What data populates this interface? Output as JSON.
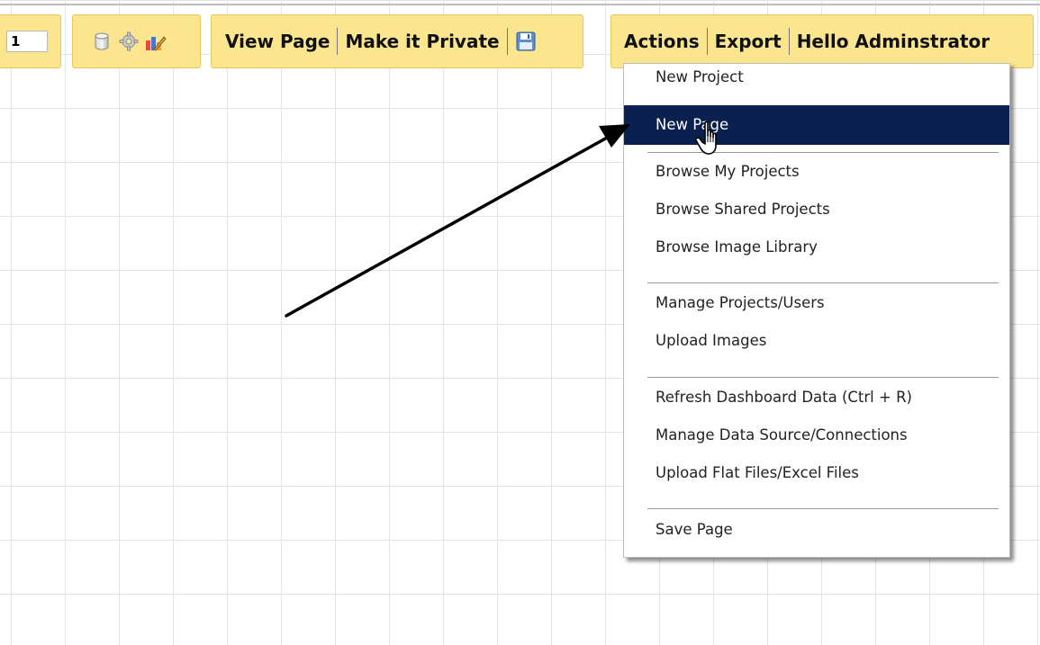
{
  "toolbar": {
    "page_number_value": "1",
    "icons": [
      "database-icon",
      "gear-icon",
      "chart-edit-icon",
      "save-icon"
    ],
    "view_page_label": "View Page",
    "make_private_label": "Make it Private",
    "actions_label": "Actions",
    "export_label": "Export",
    "greeting_label": "Hello Adminstrator"
  },
  "actions_menu": {
    "items": [
      {
        "label": "New Project"
      },
      {
        "label": "New Page"
      },
      {
        "label": "Browse My Projects"
      },
      {
        "label": "Browse Shared Projects"
      },
      {
        "label": "Browse Image Library"
      },
      {
        "label": "Manage Projects/Users"
      },
      {
        "label": "Upload Images"
      },
      {
        "label": "Refresh Dashboard Data (Ctrl + R)"
      },
      {
        "label": "Manage Data Source/Connections"
      },
      {
        "label": "Upload Flat Files/Excel Files"
      },
      {
        "label": "Save Page"
      }
    ],
    "selected_item": "New Page"
  },
  "colors": {
    "toolbar_background": "#fbe58e",
    "toolbar_border": "#e6c85a",
    "selected_menu_background": "#0a2050",
    "selected_menu_text": "#ffffff",
    "grid_line": "#e4e4e4",
    "annotation_arrow": "#000000"
  }
}
